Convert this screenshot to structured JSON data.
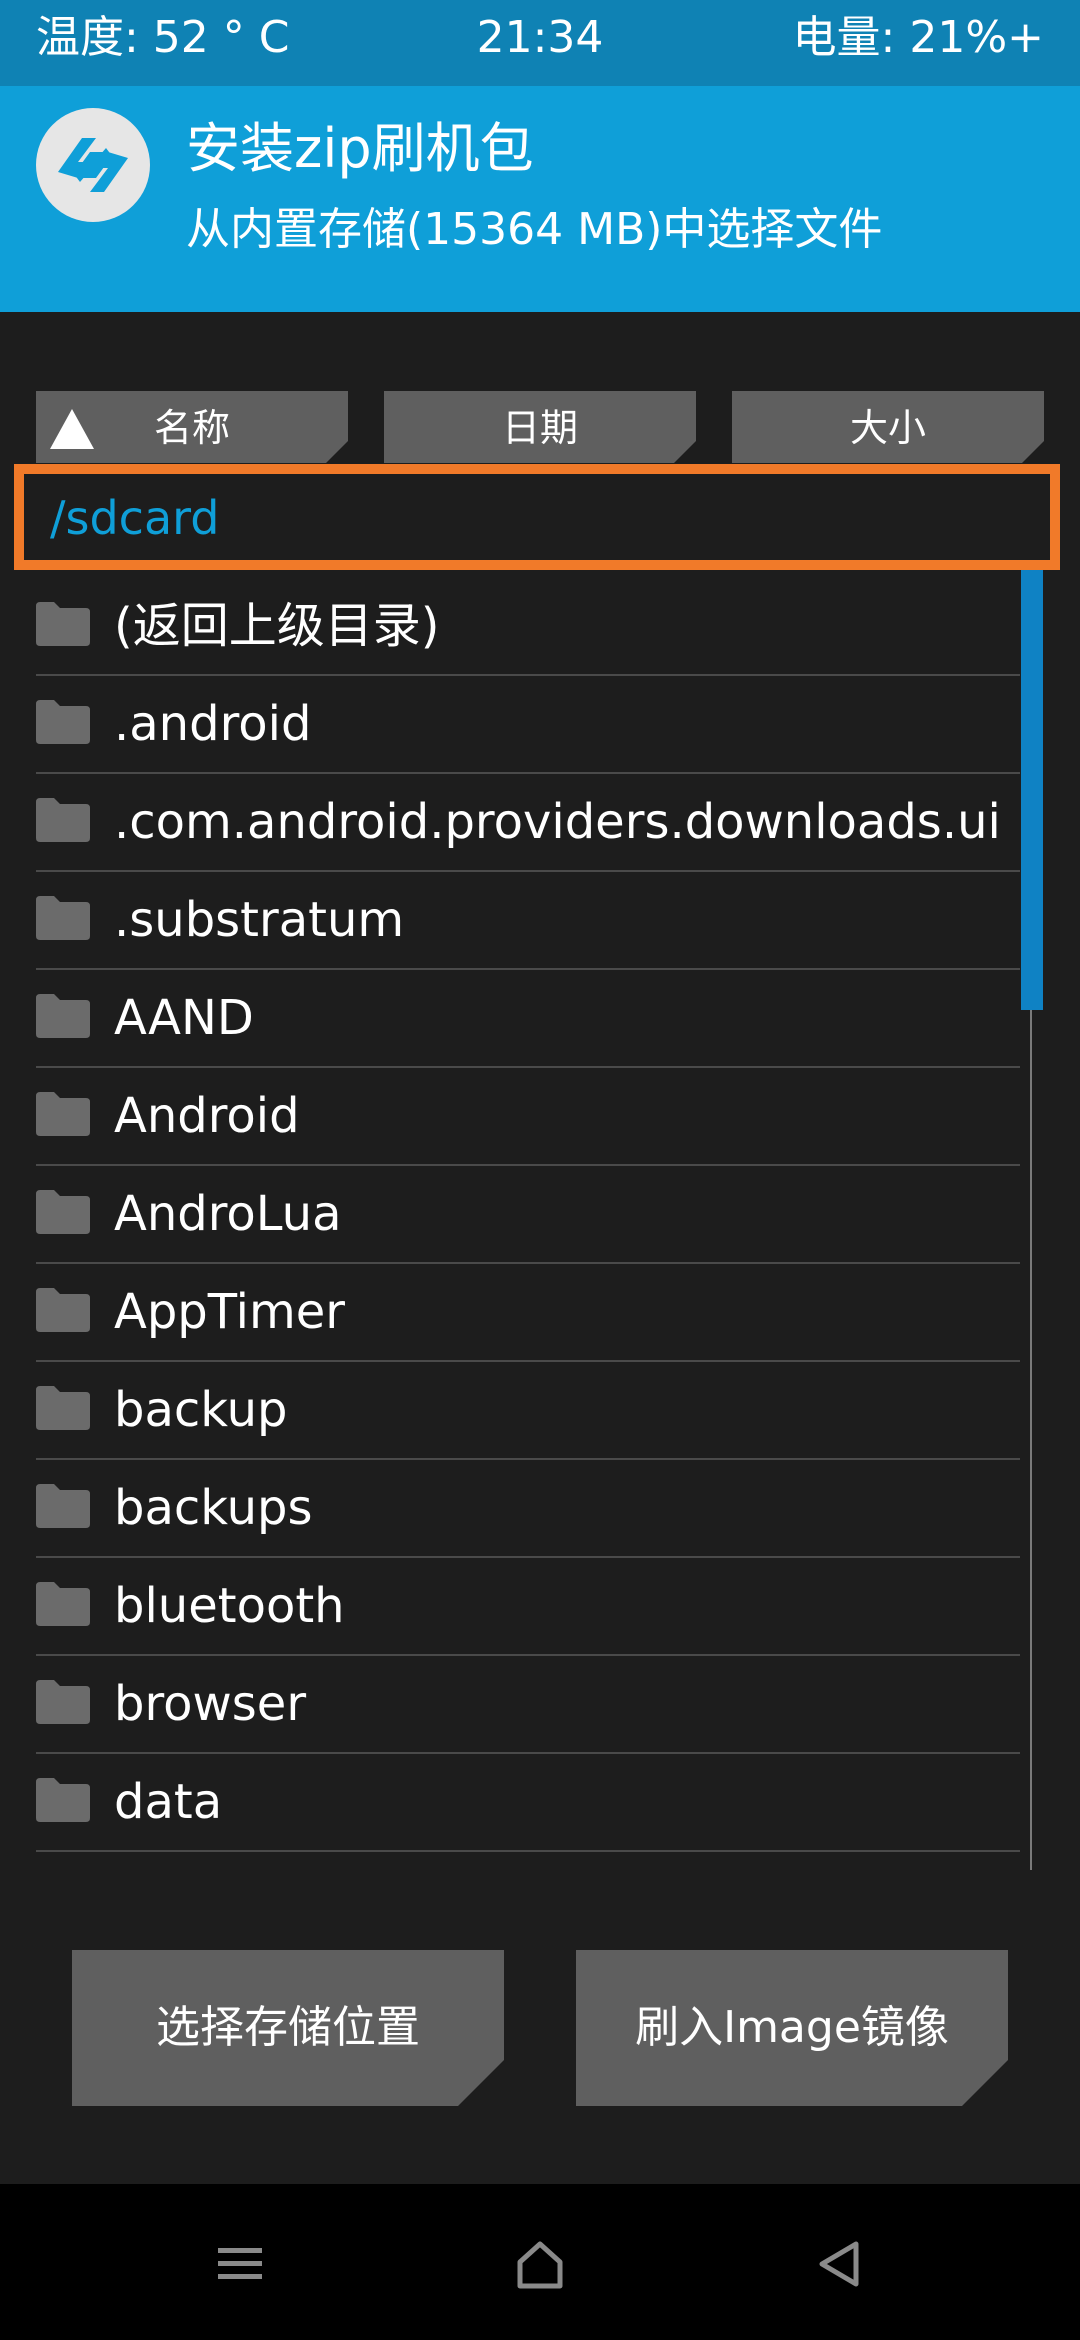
{
  "status_bar": {
    "temperature": "温度: 52 ° C",
    "time": "21:34",
    "battery": "电量: 21%+"
  },
  "header": {
    "logo_icon": "twrp-logo-icon",
    "title": "安装zip刷机包",
    "subtitle": "从内置存储(15364 MB)中选择文件"
  },
  "sort_buttons": {
    "name": "名称",
    "date": "日期",
    "size": "大小",
    "active": "name"
  },
  "current_path": "/sdcard",
  "files": [
    "(返回上级目录)",
    ".android",
    ".com.android.providers.downloads.ui",
    ".substratum",
    "AAND",
    "Android",
    "AndroLua",
    "AppTimer",
    "backup",
    "backups",
    "bluetooth",
    "browser",
    "data"
  ],
  "actions": {
    "select_storage": "选择存储位置",
    "flash_image": "刷入Image镜像"
  },
  "navbar": {
    "menu_icon": "menu-icon",
    "home_icon": "home-icon",
    "back_icon": "back-icon"
  },
  "colors": {
    "status_bar": "#0f82b4",
    "header": "#0f9fd8",
    "highlight": "#f17a29",
    "path_text": "#0f9fd8",
    "background": "#1d1d1d",
    "button": "#5f5f5f"
  }
}
